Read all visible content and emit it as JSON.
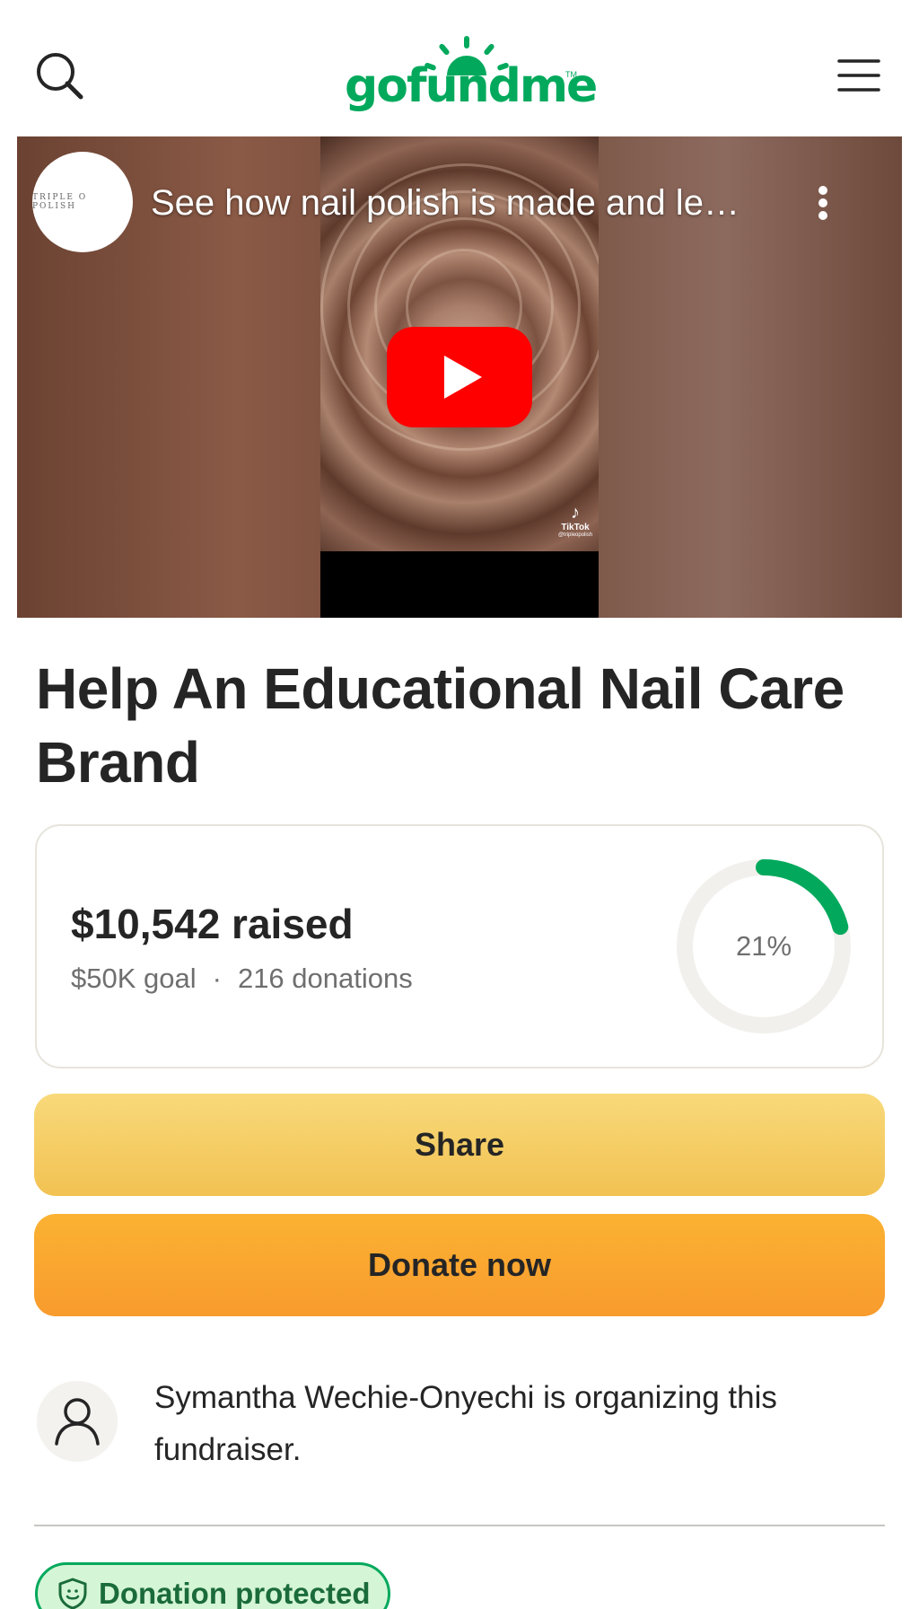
{
  "header": {
    "logo_text": "gofundme",
    "logo_tm": "TM"
  },
  "video": {
    "channel_name": "TRIPLE O POLISH",
    "title": "See how nail polish is made and le…",
    "platform_watermark": "TikTok",
    "platform_handle": "@tripleopolish"
  },
  "campaign": {
    "title": "Help An Educational Nail Care Brand",
    "raised": "$10,542 raised",
    "goal": "$50K goal",
    "separator": "·",
    "donations": "216 donations",
    "progress_label": "21%",
    "progress_fraction": 0.21
  },
  "actions": {
    "share_label": "Share",
    "donate_label": "Donate now"
  },
  "organizer": {
    "text": "Symantha Wechie-Onyechi is organizing this fundraiser."
  },
  "badge": {
    "label": "Donation protected"
  },
  "colors": {
    "brand_green": "#02a95c",
    "share_yellow": "#f5cd65",
    "donate_orange": "#f9a630",
    "youtube_red": "#ff0000"
  },
  "icons": {
    "search": "search-icon",
    "menu": "hamburger-menu-icon",
    "play": "youtube-play-icon",
    "more": "more-vertical-icon",
    "organizer": "user-icon",
    "badge": "shield-icon"
  }
}
